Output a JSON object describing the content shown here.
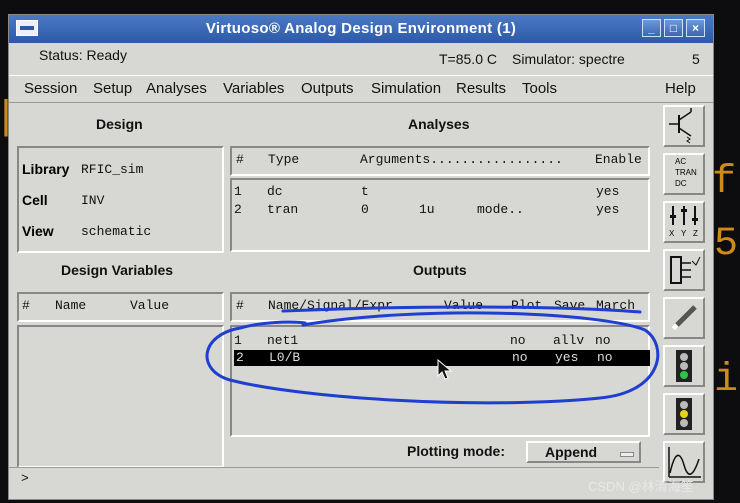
{
  "window": {
    "title": "Virtuoso® Analog Design Environment (1)"
  },
  "status": {
    "text": "Status: Ready",
    "temp": "T=85.0 C",
    "simulator": "Simulator: spectre",
    "number": "5"
  },
  "menu": [
    "Session",
    "Setup",
    "Analyses",
    "Variables",
    "Outputs",
    "Simulation",
    "Results",
    "Tools",
    "Help"
  ],
  "design": {
    "title": "Design",
    "library_label": "Library",
    "library_value": "RFIC_sim",
    "cell_label": "Cell",
    "cell_value": "INV",
    "view_label": "View",
    "view_value": "schematic"
  },
  "analyses": {
    "title": "Analyses",
    "headers": {
      "num": "#",
      "type": "Type",
      "args": "Arguments.................",
      "enable": "Enable"
    },
    "rows": [
      {
        "num": "1",
        "type": "dc",
        "a1": "t",
        "a2": "",
        "a3": "",
        "enable": "yes"
      },
      {
        "num": "2",
        "type": "tran",
        "a1": "0",
        "a2": "1u",
        "a3": "mode..",
        "enable": "yes"
      }
    ]
  },
  "design_variables": {
    "title": "Design Variables",
    "headers": {
      "num": "#",
      "name": "Name",
      "value": "Value"
    }
  },
  "outputs": {
    "title": "Outputs",
    "headers": {
      "num": "#",
      "name": "Name/Signal/Expr",
      "value": "Value",
      "plot": "Plot",
      "save": "Save",
      "march": "March"
    },
    "rows": [
      {
        "num": "1",
        "name": "net1",
        "value": "",
        "plot": "no",
        "save": "allv",
        "march": "no"
      },
      {
        "num": "2",
        "name": "L0/B",
        "value": "",
        "plot": "no",
        "save": "yes",
        "march": "no"
      }
    ]
  },
  "plotting": {
    "label": "Plotting mode:",
    "value": "Append"
  },
  "toolbar": {
    "ac_tran_dc": [
      "AC",
      "TRAN",
      "DC"
    ],
    "xyz": [
      "X",
      "Y",
      "Z"
    ]
  },
  "cmdline": {
    "prompt": ">"
  },
  "watermark": "CSDN @林清海笙",
  "colors": {
    "titlebar": "#2b5aa8",
    "annotation": "#1e3fd0",
    "background_text": "#d08a1a"
  }
}
